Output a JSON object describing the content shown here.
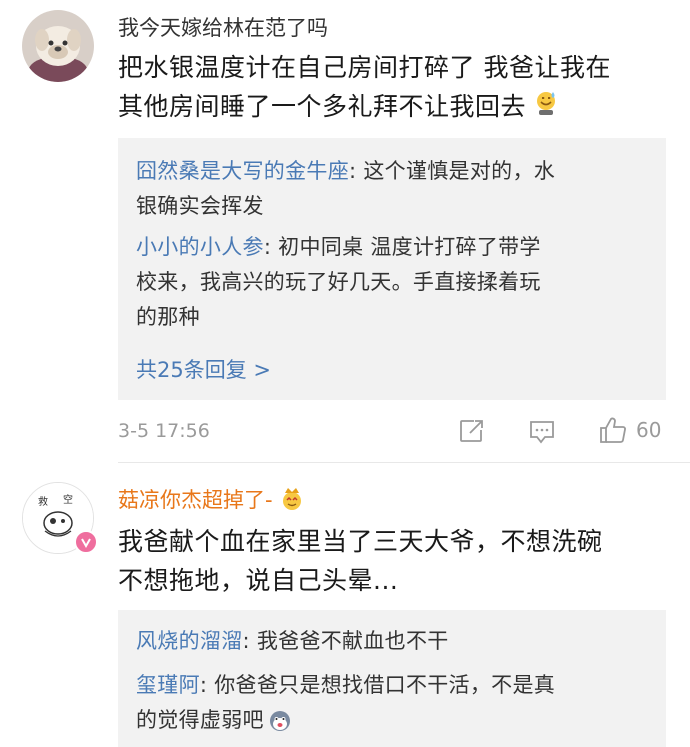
{
  "comments": [
    {
      "username": "我今天嫁给林在范了吗",
      "text_line1": "把水银温度计在自己房间打碎了 我爸让我在",
      "text_line2": "其他房间睡了一个多礼拜不让我回去",
      "replies": [
        {
          "name": "囧然桑是大写的金牛座",
          "line1": ": 这个谨慎是对的，水",
          "line2": "银确实会挥发"
        },
        {
          "name": "小小的小人参",
          "line1": ": 初中同桌 温度计打碎了带学",
          "line2": "校来，我高兴的玩了好几天。手直接揉着玩",
          "line3": "的那种"
        }
      ],
      "more_replies": "共25条回复 >",
      "timestamp": "3-5 17:56",
      "like_count": "60"
    },
    {
      "username": "菇凉你杰超掉了-",
      "avatar_text": "救  空",
      "text_line1": "我爸献个血在家里当了三天大爷，不想洗碗",
      "text_line2": "不想拖地，说自己头晕...",
      "replies": [
        {
          "name": "风烧的溜溜",
          "line1": ": 我爸爸不献血也不干"
        },
        {
          "name": "玺瑾阿",
          "line1": ": 你爸爸只是想找借口不干活，不是真",
          "line2": "的觉得虚弱吧"
        }
      ]
    }
  ],
  "icons": {
    "share": "share-icon",
    "comment": "comment-icon",
    "like": "thumbs-up-icon",
    "verified": "verified-badge-icon",
    "crown": "crown-emoji-icon"
  },
  "colors": {
    "link_blue": "#4a7ab5",
    "orange_name": "#e8771a",
    "reply_bg": "#f2f2f2",
    "meta_gray": "#9a9a9a"
  }
}
